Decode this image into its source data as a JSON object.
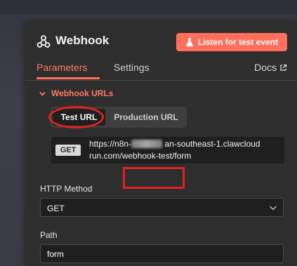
{
  "node": {
    "title": "Webhook",
    "icon": "webhook-icon",
    "listen_button": "Listen for test event",
    "listen_icon": "flask-icon"
  },
  "tabs": [
    {
      "label": "Parameters",
      "active": true
    },
    {
      "label": "Settings",
      "active": false
    }
  ],
  "docs": {
    "label": "Docs",
    "icon": "external-link-icon"
  },
  "webhook_urls": {
    "section_title": "Webhook URLs",
    "toggle": {
      "test": "Test URL",
      "production": "Production URL",
      "selected": "Test URL"
    },
    "method": "GET",
    "url_part1": "https://n8n-",
    "url_part2": "an-southeast-1.clawcloud",
    "url_part3": "run.com/",
    "url_highlight": "webhook-test",
    "url_part4": "/form"
  },
  "fields": {
    "http_method_label": "HTTP Method",
    "http_method_value": "GET",
    "path_label": "Path",
    "path_value": "form"
  },
  "colors": {
    "accent": "#ff6f5c",
    "annotation": "#e0231e",
    "panel": "#2e2e2e"
  }
}
